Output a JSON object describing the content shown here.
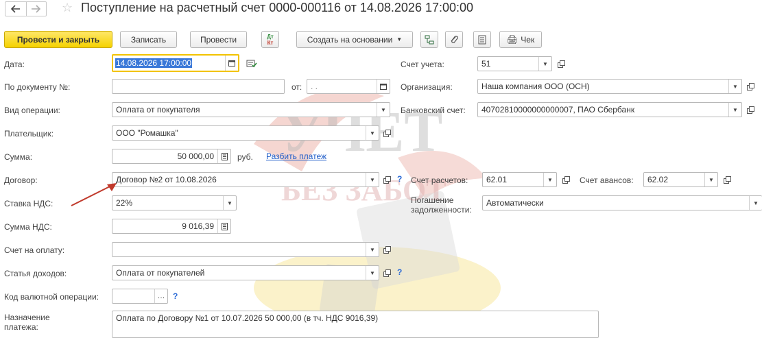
{
  "header": {
    "title": "Поступление на расчетный счет 0000-000116 от 14.08.2026 17:00:00"
  },
  "toolbar": {
    "post_and_close": "Провести и закрыть",
    "save": "Записать",
    "post": "Провести",
    "dtkt_top": "Дт",
    "dtkt_bottom": "Кт",
    "create_based_on": "Создать на основании",
    "receipt": "Чек"
  },
  "form": {
    "date": {
      "label": "Дата:",
      "value": "14.08.2026 17:00:00"
    },
    "doc_number": {
      "label": "По документу №:",
      "value": "",
      "from_label": "от:",
      "from_value": " .  ."
    },
    "operation_type": {
      "label": "Вид операции:",
      "value": "Оплата от покупателя"
    },
    "payer": {
      "label": "Плательщик:",
      "value": "ООО \"Ромашка\""
    },
    "amount": {
      "label": "Сумма:",
      "value": "50 000,00",
      "currency": "руб.",
      "split_link": "Разбить платеж"
    },
    "contract": {
      "label": "Договор:",
      "value": "Договор №2 от 10.08.2026"
    },
    "vat_rate": {
      "label": "Ставка НДС:",
      "value": "22%"
    },
    "vat_amount": {
      "label": "Сумма НДС:",
      "value": "9 016,39"
    },
    "invoice": {
      "label": "Счет на оплату:",
      "value": ""
    },
    "income_item": {
      "label": "Статья доходов:",
      "value": "Оплата от покупателей"
    },
    "currency_op_code": {
      "label": "Код валютной операции:",
      "value": ""
    },
    "purpose": {
      "label_line1": "Назначение",
      "label_line2": "платежа:",
      "value": "Оплата по Договору №1 от 10.07.2026 50 000,00 (в тч. НДС 9016,39)"
    },
    "account": {
      "label": "Счет учета:",
      "value": "51"
    },
    "organization": {
      "label": "Организация:",
      "value": "Наша компания ООО (ОСН)"
    },
    "bank_account": {
      "label": "Банковский счет:",
      "value": "40702810000000000007, ПАО Сбербанк"
    },
    "settlement_account": {
      "label": "Счет расчетов:",
      "value": "62.01"
    },
    "advance_account": {
      "label": "Счет авансов:",
      "value": "62.02"
    },
    "debt_repayment": {
      "label_line1": "Погашение",
      "label_line2": "задолженности:",
      "value": "Автоматически"
    },
    "help_mark": "?"
  },
  "watermark": {
    "line1": "УЧЕТ",
    "line2": "БЕЗ ЗАБОТ"
  },
  "colors": {
    "primary_button": "#f5d200",
    "link": "#1e5cc8",
    "help": "#2a6ad6",
    "arrow": "#c0392b",
    "date_focus": "#f2c300",
    "selection": "#3a78d8"
  }
}
